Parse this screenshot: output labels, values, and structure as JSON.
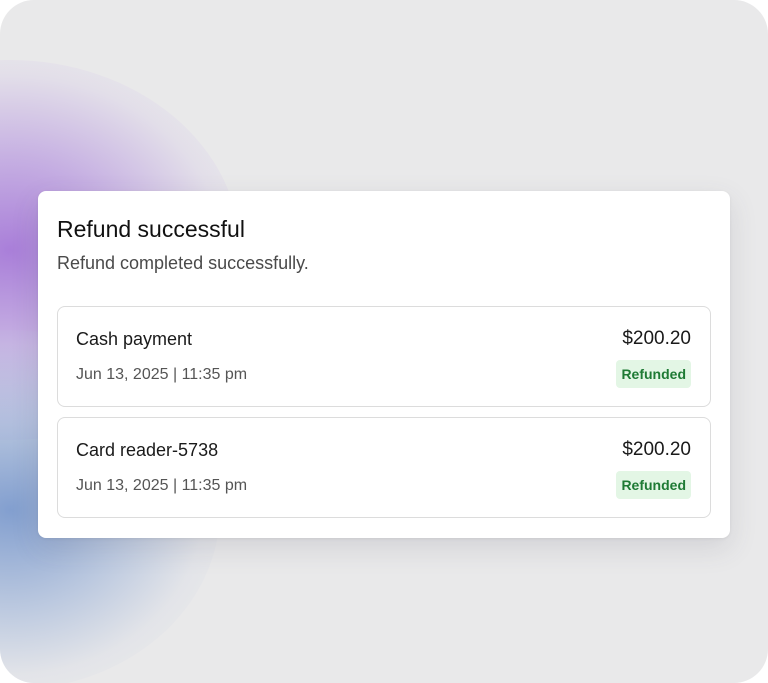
{
  "dialog": {
    "title": "Refund successful",
    "message": "Refund completed successfully."
  },
  "refunds": [
    {
      "method": "Cash payment",
      "datetime": "Jun 13, 2025 | 11:35 pm",
      "amount": "$200.20",
      "status": "Refunded"
    },
    {
      "method": "Card reader-5738",
      "datetime": "Jun 13, 2025 | 11:35 pm",
      "amount": "$200.20",
      "status": "Refunded"
    }
  ],
  "colors": {
    "status_text": "#1e7a34",
    "status_background": "#e3f6e5",
    "background_purple": "#9e6cd6",
    "background_blue": "#6086c6"
  }
}
